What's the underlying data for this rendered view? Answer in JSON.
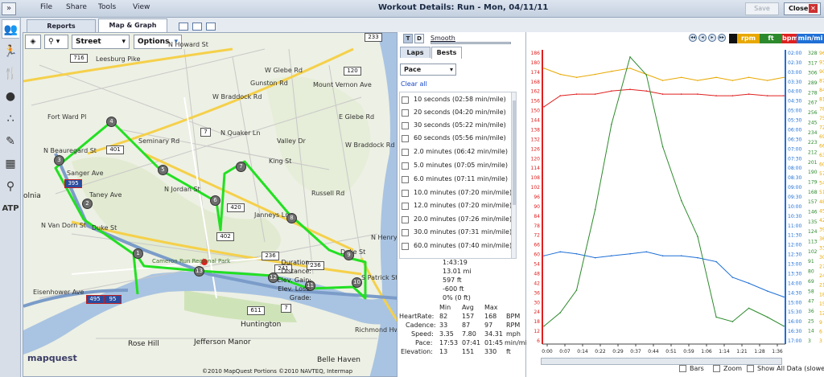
{
  "window": {
    "expand_icon": "»",
    "menu": [
      "File",
      "Share",
      "Tools",
      "View"
    ],
    "title": "Workout Details: Run - Mon, 04/11/11",
    "save_label": "Save",
    "close_label": "Close"
  },
  "tabs": {
    "reports": "Reports",
    "map_graph": "Map & Graph"
  },
  "sidebar_icon_text": "ATP",
  "map": {
    "street_label": "Street",
    "options_label": "Options",
    "logo": "mapquest",
    "copyright": "©2010 MapQuest  Portions ©2010 NAVTEQ, Intermap",
    "labels": [
      {
        "t": "Leesburg Pike"
      },
      {
        "t": "N Beauregard St"
      },
      {
        "t": "Sanger Ave"
      },
      {
        "t": "Seminary Rd"
      },
      {
        "t": "N Jordan St"
      },
      {
        "t": "Taney Ave"
      },
      {
        "t": "N Van Dorn St"
      },
      {
        "t": "Duke St"
      },
      {
        "t": "N Quaker Ln"
      },
      {
        "t": "King St"
      },
      {
        "t": "Janneys Ln"
      },
      {
        "t": "W Braddock Rd"
      },
      {
        "t": "W Glebe Rd"
      },
      {
        "t": "Gunston Rd"
      },
      {
        "t": "Valley Dr"
      },
      {
        "t": "Mount Vernon Ave"
      },
      {
        "t": "Russell Rd"
      },
      {
        "t": "W Braddock Rd"
      },
      {
        "t": "E Glebe Rd"
      },
      {
        "t": "N Henry St"
      },
      {
        "t": "S Patrick St"
      },
      {
        "t": "Richmond Hwy"
      },
      {
        "t": "Eisenhower Ave"
      },
      {
        "t": "Cameron Run Regional Park"
      },
      {
        "t": "Duke St"
      },
      {
        "t": "Huntington"
      },
      {
        "t": "Rose Hill"
      },
      {
        "t": "Jefferson Manor"
      },
      {
        "t": "Belle Haven"
      },
      {
        "t": "olnia"
      },
      {
        "t": "N Howard St"
      },
      {
        "t": "Fort Ward Pl"
      }
    ],
    "shields": [
      "716",
      "233",
      "401",
      "7",
      "420",
      "402",
      "236",
      "236",
      "241",
      "611",
      "7",
      "120",
      "395",
      "495",
      "95"
    ],
    "mile_markers": [
      "1",
      "2",
      "3",
      "4",
      "5",
      "6",
      "7",
      "8",
      "9",
      "10",
      "11",
      "12",
      "13"
    ]
  },
  "side": {
    "toggle_t": "T",
    "toggle_d": "D",
    "smooth": "Smooth",
    "tab_laps": "Laps",
    "tab_bests": "Bests",
    "metric": "Pace",
    "clear_all": "Clear all",
    "bests": [
      "10 seconds (02:58 min/mile)",
      "20 seconds (04:20 min/mile)",
      "30 seconds (05:22 min/mile)",
      "60 seconds (05:56 min/mile)",
      "2.0 minutes (06:42 min/mile)",
      "5.0 minutes (07:05 min/mile)",
      "6.0 minutes (07:11 min/mile)",
      "10.0 minutes (07:20 min/mile)",
      "12.0 minutes (07:20 min/mile)",
      "20.0 minutes (07:26 min/mile)",
      "30.0 minutes (07:31 min/mile)",
      "60.0 minutes (07:40 min/mile)"
    ],
    "summary": [
      {
        "k": "Duration:",
        "v": "1:43:19"
      },
      {
        "k": "Distance:",
        "v": "13.01 mi"
      },
      {
        "k": "Elev. Gain:",
        "v": "597 ft"
      },
      {
        "k": "Elev. Loss:",
        "v": "-600 ft"
      },
      {
        "k": "Grade:",
        "v": "0% (0 ft)"
      }
    ],
    "table_headers": [
      "Min",
      "Avg",
      "Max"
    ],
    "table": [
      {
        "k": "HeartRate:",
        "min": "82",
        "avg": "157",
        "max": "168",
        "u": "BPM"
      },
      {
        "k": "Cadence:",
        "min": "33",
        "avg": "87",
        "max": "97",
        "u": "RPM"
      },
      {
        "k": "Speed:",
        "min": "3.35",
        "avg": "7.80",
        "max": "34.31",
        "u": "mph"
      },
      {
        "k": "Pace:",
        "min": "17:53",
        "avg": "07:41",
        "max": "01:45",
        "u": "min/mi"
      },
      {
        "k": "Elevation:",
        "min": "13",
        "avg": "151",
        "max": "330",
        "u": "ft"
      }
    ]
  },
  "graph": {
    "legend": [
      {
        "t": "rpm",
        "color": "#e8a800"
      },
      {
        "t": "ft",
        "color": "#2c8a2c"
      },
      {
        "t": "bpm",
        "color": "#e02020"
      },
      {
        "t": "min/mi",
        "color": "#1f6fd6"
      }
    ],
    "bars_label": "Bars",
    "zoom_label": "Zoom",
    "show_all_label": "Show All Data (slower)"
  },
  "chart_data": {
    "type": "line",
    "x_ticks": [
      "0:00",
      "0:07",
      "0:14",
      "0:22",
      "0:29",
      "0:37",
      "0:44",
      "0:51",
      "0:59",
      "1:06",
      "1:14",
      "1:21",
      "1:28",
      "1:36"
    ],
    "y_left_bpm": [
      "186",
      "180",
      "174",
      "168",
      "162",
      "156",
      "150",
      "144",
      "138",
      "132",
      "126",
      "120",
      "114",
      "108",
      "102",
      "96",
      "90",
      "84",
      "78",
      "72",
      "66",
      "60",
      "54",
      "48",
      "42",
      "36",
      "30",
      "24",
      "18",
      "12",
      "6"
    ],
    "y_right_pace": [
      "02:00",
      "02:30",
      "03:00",
      "03:30",
      "04:00",
      "04:30",
      "05:00",
      "05:30",
      "06:00",
      "06:30",
      "07:00",
      "07:30",
      "08:00",
      "08:30",
      "09:00",
      "09:30",
      "10:00",
      "10:30",
      "11:00",
      "11:30",
      "12:00",
      "12:30",
      "13:00",
      "13:30",
      "14:00",
      "14:30",
      "15:00",
      "15:30",
      "16:00",
      "16:30",
      "17:00"
    ],
    "y_right_ft": [
      "328",
      "317",
      "306",
      "289",
      "278",
      "267",
      "256",
      "245",
      "234",
      "223",
      "212",
      "201",
      "190",
      "179",
      "168",
      "157",
      "146",
      "135",
      "124",
      "113",
      "102",
      "91",
      "80",
      "69",
      "58",
      "47",
      "36",
      "25",
      "14",
      "3"
    ],
    "y_right_rpm": [
      "96",
      "93",
      "90",
      "87",
      "84",
      "81",
      "78",
      "75",
      "72",
      "69",
      "66",
      "63",
      "60",
      "57",
      "54",
      "51",
      "48",
      "45",
      "42",
      "39",
      "36",
      "33",
      "30",
      "27",
      "24",
      "21",
      "18",
      "15",
      "12",
      "9",
      "6",
      "3"
    ],
    "series": [
      {
        "name": "rpm",
        "x": [
          0,
          7,
          14,
          22,
          29,
          37,
          44,
          51,
          59,
          66,
          74,
          81,
          88,
          96,
          103
        ],
        "values": [
          90,
          88,
          87,
          88,
          89,
          90,
          88,
          86,
          87,
          86,
          87,
          86,
          87,
          86,
          87
        ]
      },
      {
        "name": "bpm",
        "x": [
          0,
          7,
          14,
          22,
          29,
          37,
          44,
          51,
          59,
          66,
          74,
          81,
          88,
          96,
          103
        ],
        "values": [
          150,
          157,
          158,
          158,
          160,
          161,
          160,
          158,
          158,
          158,
          157,
          157,
          158,
          157,
          157
        ]
      },
      {
        "name": "ft",
        "x": [
          0,
          7,
          14,
          22,
          29,
          37,
          44,
          51,
          59,
          66,
          74,
          81,
          88,
          96,
          103
        ],
        "values": [
          20,
          35,
          60,
          150,
          245,
          320,
          300,
          220,
          160,
          120,
          30,
          25,
          40,
          30,
          20
        ]
      },
      {
        "name": "min/mi",
        "x": [
          0,
          7,
          14,
          22,
          29,
          37,
          44,
          51,
          59,
          66,
          74,
          81,
          88,
          96,
          103
        ],
        "values": [
          12.5,
          12.3,
          12.4,
          12.6,
          12.5,
          12.4,
          12.3,
          12.5,
          12.5,
          12.6,
          12.8,
          13.6,
          13.9,
          14.3,
          14.6
        ]
      }
    ]
  }
}
